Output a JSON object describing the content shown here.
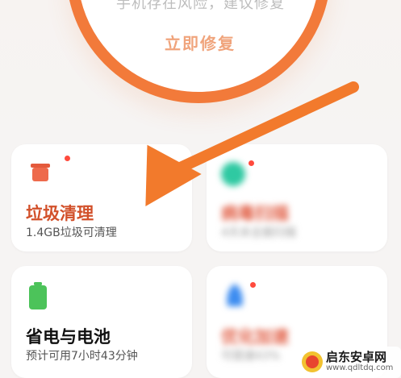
{
  "security": {
    "risk_text": "手机存在风险，建议修复",
    "fix_label": "立即修复"
  },
  "cards": {
    "junk": {
      "title": "垃圾清理",
      "subtitle": "1.4GB垃圾可清理"
    },
    "virus": {
      "title": "病毒扫描",
      "subtitle": "4天未全面扫描"
    },
    "battery": {
      "title": "省电与电池",
      "subtitle": "预计可用7小时43分钟"
    },
    "boost": {
      "title": "优化加速",
      "subtitle": "可提速43%"
    }
  },
  "colors": {
    "accent": "#f27a3a",
    "junk_title": "#d2502a",
    "notify_dot": "#ff4a3d",
    "battery_green": "#4cc35a",
    "virus_green": "#2fc9a2",
    "boost_blue": "#3c8cf0"
  },
  "watermark": {
    "title": "启东安卓网",
    "url": "www.qdltdq.com"
  }
}
